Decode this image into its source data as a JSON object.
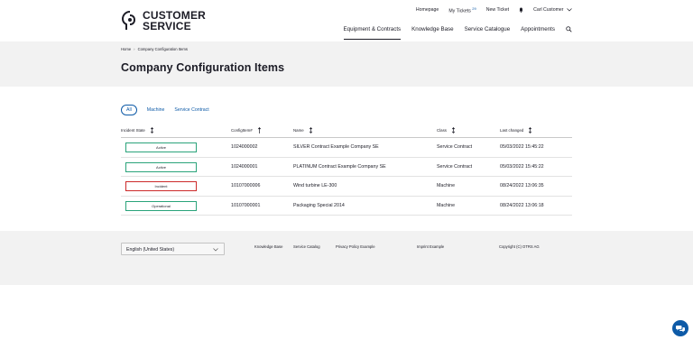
{
  "brand": {
    "line1": "CUSTOMER",
    "line2": "SERVICE"
  },
  "top_links": {
    "homepage": "Homepage",
    "my_tickets": "My Tickets",
    "my_tickets_count": "29",
    "new_ticket": "New Ticket",
    "user": "Carl Customer"
  },
  "main_nav": [
    "Equipment & Contracts",
    "Knowledge Base",
    "Service Catalogue",
    "Appointments"
  ],
  "breadcrumb": [
    "Home",
    "Company Configuration Items"
  ],
  "page_title": "Company Configuration Items",
  "filters": [
    "All",
    "Machine",
    "Service Contract"
  ],
  "table": {
    "headers": [
      "Incident State",
      "ConfigItem#",
      "Name",
      "Class",
      "Last changed"
    ],
    "rows": [
      {
        "state": "Active",
        "number": "1024000002",
        "name": "SILVER Contract Example Company SE",
        "class": "Service Contract",
        "changed": "05/03/2022 15:45:22"
      },
      {
        "state": "Active",
        "number": "1024000001",
        "name": "PLATINUM Contract Example Company SE",
        "class": "Service Contract",
        "changed": "05/03/2022 15:45:22"
      },
      {
        "state": "Incident",
        "number": "10107000006",
        "name": "Wind turbine LE-300",
        "class": "Machine",
        "changed": "08/24/2022 13:06:35"
      },
      {
        "state": "Operational",
        "number": "10107000001",
        "name": "Packaging Special 2014",
        "class": "Machine",
        "changed": "08/24/2022 13:06:18"
      }
    ]
  },
  "footer": {
    "language": "English (United States)",
    "links": [
      "Knowledge Base",
      "Service Catalog",
      "Privacy Policy Example",
      "Imprint Example"
    ],
    "copyright": "Copyright (C) OTRS AG"
  },
  "colors": {
    "accent": "#0d5aa7",
    "ok": "#2aa37a",
    "incident": "#cc2a2a",
    "band": "#f2f2f2"
  },
  "icons": [
    "logo-mark-icon",
    "bell-icon",
    "chevron-down-icon",
    "search-icon",
    "sort-icon",
    "sort-up-icon",
    "chat-icon"
  ]
}
